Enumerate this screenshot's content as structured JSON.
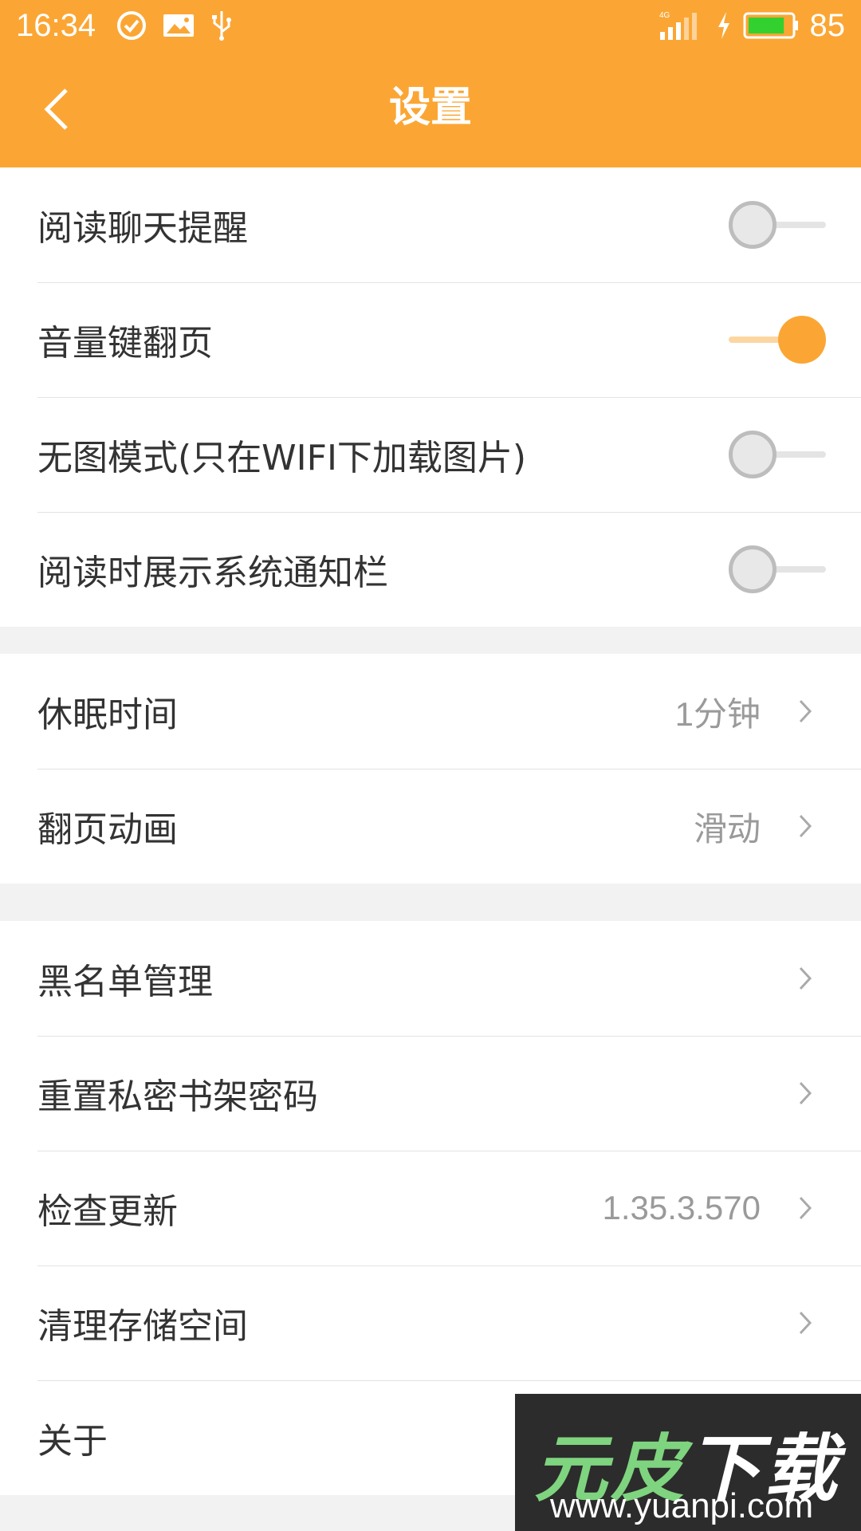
{
  "status_bar": {
    "time": "16:34",
    "network": "4G",
    "battery_percent": "85",
    "battery_level": 0.85,
    "left_icons": [
      "check-circle-icon",
      "image-icon",
      "usb-icon"
    ],
    "right_icons": [
      "signal-icon",
      "charging-icon",
      "battery-icon"
    ]
  },
  "header": {
    "title": "设置",
    "back_icon": "chevron-left-icon"
  },
  "sections": [
    {
      "rows": [
        {
          "label": "阅读聊天提醒",
          "toggle": false
        },
        {
          "label": "音量键翻页",
          "toggle": true
        },
        {
          "label": "无图模式(只在WIFI下加载图片)",
          "toggle": false
        },
        {
          "label": "阅读时展示系统通知栏",
          "toggle": false
        }
      ]
    },
    {
      "rows": [
        {
          "label": "休眠时间",
          "value": "1分钟"
        },
        {
          "label": "翻页动画",
          "value": "滑动"
        }
      ]
    },
    {
      "rows": [
        {
          "label": "黑名单管理"
        },
        {
          "label": "重置私密书架密码"
        },
        {
          "label": "检查更新",
          "value": "1.35.3.570"
        },
        {
          "label": "清理存储空间"
        },
        {
          "label": "关于"
        }
      ]
    }
  ],
  "watermark": {
    "logo_text_a": "元皮",
    "logo_text_b": "下载",
    "url": "www.yuanpi.com"
  },
  "colors": {
    "accent": "#fba634",
    "toggle_track_on": "#fcd6a1",
    "background": "#f2f2f2"
  }
}
